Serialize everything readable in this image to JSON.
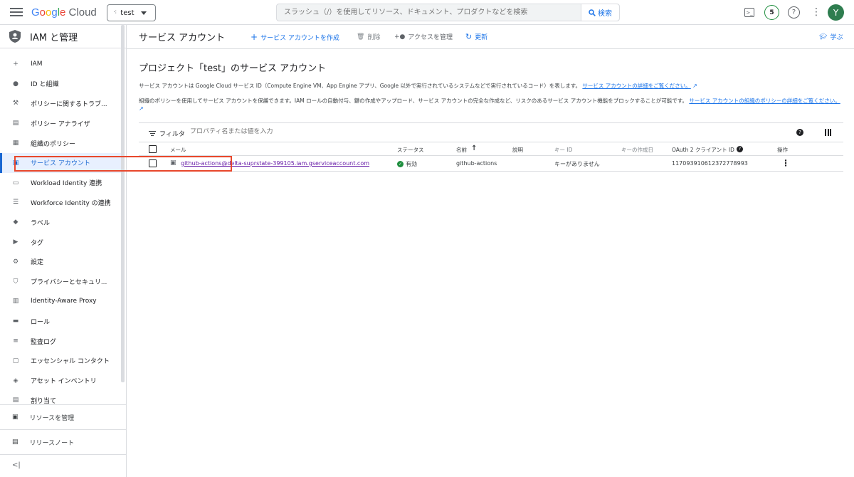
{
  "topbar": {
    "logo": "Google Cloud",
    "logo_parts": [
      "G",
      "o",
      "o",
      "g",
      "l",
      "e"
    ],
    "logo_suffix": " Cloud",
    "project": "test",
    "search_placeholder": "スラッシュ（/）を使用してリソース、ドキュメント、プロダクトなどを検索",
    "search_button": "検索",
    "notification_count": "5",
    "help": "?",
    "avatar": "Y"
  },
  "sidebar": {
    "title": "IAM と管理",
    "items": [
      {
        "label": "IAM",
        "icon": "person-add-icon",
        "glyph": "+"
      },
      {
        "label": "ID と組織",
        "icon": "account-circle-icon",
        "glyph": "●"
      },
      {
        "label": "ポリシーに関するトラブ...",
        "icon": "wrench-icon",
        "glyph": "⚒"
      },
      {
        "label": "ポリシー アナライザ",
        "icon": "policy-search-icon",
        "glyph": "▤"
      },
      {
        "label": "組織のポリシー",
        "icon": "document-icon",
        "glyph": "▦"
      },
      {
        "label": "サービス アカウント",
        "icon": "service-account-icon",
        "glyph": "▣"
      },
      {
        "label": "Workload Identity 連携",
        "icon": "badge-icon",
        "glyph": "▭"
      },
      {
        "label": "Workforce Identity の連携",
        "icon": "list-icon",
        "glyph": "☰"
      },
      {
        "label": "ラベル",
        "icon": "label-icon",
        "glyph": "◆"
      },
      {
        "label": "タグ",
        "icon": "tag-icon",
        "glyph": "▶"
      },
      {
        "label": "設定",
        "icon": "settings-icon",
        "glyph": "⚙"
      },
      {
        "label": "プライバシーとセキュリ...",
        "icon": "shield-icon",
        "glyph": "⛉"
      },
      {
        "label": "Identity-Aware Proxy",
        "icon": "proxy-icon",
        "glyph": "▥"
      },
      {
        "label": "ロール",
        "icon": "hat-icon",
        "glyph": "▬"
      },
      {
        "label": "監査ログ",
        "icon": "log-icon",
        "glyph": "≡"
      },
      {
        "label": "エッセンシャル コンタクト",
        "icon": "contact-icon",
        "glyph": "▢"
      },
      {
        "label": "アセット インベントリ",
        "icon": "inventory-icon",
        "glyph": "◈"
      },
      {
        "label": "割り当て",
        "icon": "quota-icon",
        "glyph": "▤"
      }
    ],
    "active_index": 5,
    "bottom": [
      {
        "label": "リソースを管理",
        "icon": "folder-settings-icon",
        "glyph": "▣"
      },
      {
        "label": "リリースノート",
        "icon": "release-notes-icon",
        "glyph": "▤"
      }
    ],
    "collapse": "<|"
  },
  "actionbar": {
    "title": "サービス アカウント",
    "create": "サービス アカウントを作成",
    "delete": "削除",
    "manage": "アクセスを管理",
    "refresh": "更新",
    "learn": "学ぶ"
  },
  "content": {
    "heading": "プロジェクト「test」のサービス アカウント",
    "desc1": "サービス アカウントは Google Cloud サービス ID（Compute Engine VM、App Engine アプリ、Google 以外で実行されているシステムなどで実行されているコード）を表します。",
    "desc1_link": "サービス アカウントの詳細をご覧ください。",
    "desc2": "組織のポリシーを使用してサービス アカウントを保護できます。IAM ロールの自動付与、鍵の作成やアップロード、サービス アカウントの完全な作成など、リスクのあるサービス アカウント機能をブロックすることが可能です。",
    "desc2_link": "サービス アカウントの組織のポリシーの詳細をご覧ください。"
  },
  "table": {
    "filter_label": "フィルタ",
    "filter_placeholder": "プロパティ名または値を入力",
    "columns": {
      "email": "メール",
      "status": "ステータス",
      "name": "名前",
      "description": "説明",
      "key_id": "キー ID",
      "key_created": "キーの作成日",
      "oauth": "OAuth 2 クライアント ID",
      "actions": "操作"
    },
    "rows": [
      {
        "email": "github-actions@delta-suprstate-399105.iam.gserviceaccount.com",
        "status": "有効",
        "name": "github-actions",
        "description": "",
        "key_id": "キーがありません",
        "key_created": "",
        "oauth": "117093910612372778993"
      }
    ]
  },
  "colors": {
    "accent": "#1a73e8",
    "active_bg": "#e8f0fe",
    "highlight": "#e8472c",
    "status_ok": "#1e8e3e"
  }
}
